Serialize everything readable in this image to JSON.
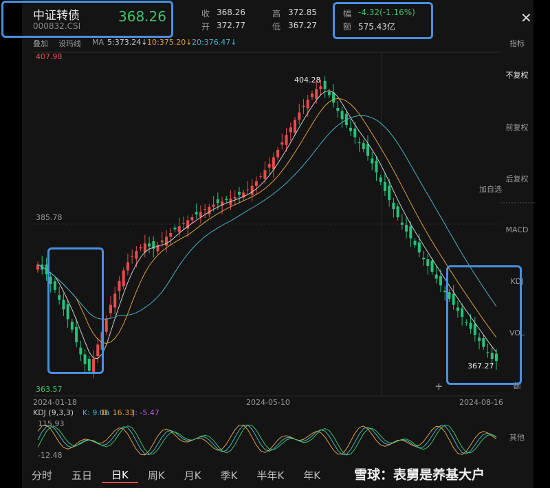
{
  "header": {
    "name": "中证转债",
    "code": "000832.CSI",
    "price": "368.26",
    "close_label": "收",
    "close_value": "368.26",
    "open_label": "开",
    "open_value": "372.77",
    "high_label": "高",
    "high_value": "372.85",
    "low_label": "低",
    "low_value": "367.27",
    "change_label": "幅",
    "change_value": "-4.32(-1.16%)",
    "amount_label": "额",
    "amount_value": "575.43亿",
    "close_icon": "close-icon"
  },
  "ma_bar": {
    "overlay": "叠加",
    "draw": "设玛线",
    "ma": "MA",
    "ma5": "5:373.24↓",
    "ma10": "10:375.20↓",
    "ma20": "20:376.47↓"
  },
  "side_menu": {
    "indicator": "指标",
    "no_adjust": "不复权",
    "pre_adjust": "前复权",
    "post_adjust": "后复权",
    "add_watch": "加自选",
    "macd": "MACD",
    "kdj": "KDJ",
    "vol": "VOL",
    "amount": "额",
    "other": "其他"
  },
  "chart": {
    "price_top": "407.98",
    "price_ref": "385.78",
    "price_bottom": "363.57",
    "peak_label": "404.28",
    "low_label": "367.27",
    "date_start": "2024-01-18",
    "date_mid": "2024-05-10",
    "date_end": "2024-08-16",
    "plus_icon": "+"
  },
  "kdj": {
    "title": "KDJ (9,3,3)",
    "k": "K: 9.06",
    "d": "D: 16.33",
    "j": "J: -5.47",
    "top": "115.93",
    "bottom": "-12.48"
  },
  "tabs": [
    "分时",
    "五日",
    "日K",
    "周K",
    "月K",
    "季K",
    "半年K",
    "年K"
  ],
  "active_tab": "日K",
  "watermark": "雪球：表舅是养基大户",
  "colors": {
    "up": "#e84b4b",
    "down": "#27c27a",
    "ma5": "#cfcfcf",
    "ma10": "#e0a040",
    "ma20": "#47b3c8",
    "highlight": "#4a90e2"
  },
  "chart_data": {
    "type": "candlestick",
    "x_start": "2024-01-18",
    "x_end": "2024-08-16",
    "ylim": [
      363.57,
      407.98
    ],
    "close": [
      380.2,
      379.5,
      378.9,
      377.6,
      376.8,
      375.5,
      374.2,
      372.9,
      371.5,
      369.8,
      368.2,
      366.9,
      366.0,
      367.6,
      369.5,
      371.2,
      373.0,
      374.8,
      376.3,
      378.0,
      379.4,
      380.5,
      381.3,
      382.0,
      382.5,
      383.0,
      382.6,
      382.3,
      382.8,
      383.4,
      383.9,
      384.4,
      384.9,
      385.3,
      385.7,
      386.1,
      386.5,
      386.9,
      387.2,
      387.6,
      387.9,
      388.2,
      388.4,
      388.6,
      388.8,
      389.0,
      389.2,
      389.5,
      389.8,
      390.2,
      390.7,
      391.3,
      392.0,
      392.8,
      393.6,
      394.5,
      395.5,
      396.5,
      397.5,
      398.5,
      399.5,
      400.5,
      401.4,
      402.2,
      403.0,
      403.6,
      404.0,
      403.6,
      402.8,
      401.8,
      400.7,
      399.6,
      398.8,
      398.0,
      397.2,
      396.4,
      395.6,
      394.7,
      393.7,
      392.5,
      391.2,
      390.0,
      388.8,
      387.6,
      386.5,
      385.5,
      384.6,
      383.7,
      382.8,
      381.8,
      380.9,
      380.0,
      379.2,
      378.3,
      377.4,
      376.5,
      375.6,
      374.8,
      374.0,
      373.2,
      372.4,
      371.6,
      370.8,
      370.0,
      369.2,
      368.4,
      367.6,
      367.3
    ]
  }
}
